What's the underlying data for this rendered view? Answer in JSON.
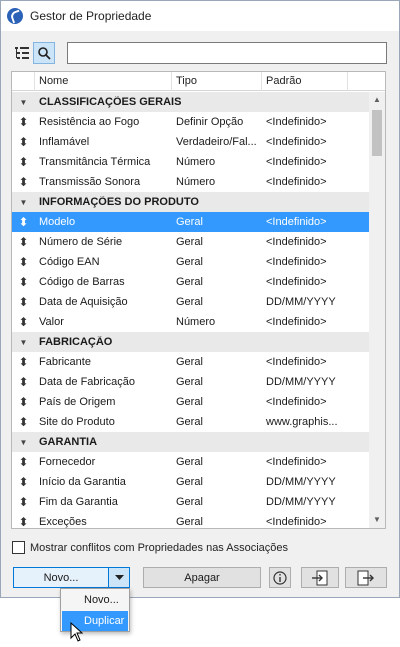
{
  "window": {
    "title": "Gestor de Propriedade",
    "icon": "app-logo-icon"
  },
  "toolbar": {
    "tree_view_icon": "tree-list-icon",
    "search_icon": "search-icon",
    "search_value": ""
  },
  "columns": {
    "name": "Nome",
    "type": "Tipo",
    "default": "Padrão"
  },
  "groups": [
    {
      "label": "CLASSIFICAÇÕES GERAIS",
      "items": [
        {
          "name": "Resistência ao Fogo",
          "type": "Definir Opção",
          "default": "<Indefinido>"
        },
        {
          "name": "Inflamável",
          "type": "Verdadeiro/Fal...",
          "default": "<Indefinido>"
        },
        {
          "name": "Transmitância Térmica",
          "type": "Número",
          "default": "<Indefinido>"
        },
        {
          "name": "Transmissão Sonora",
          "type": "Número",
          "default": "<Indefinido>"
        }
      ]
    },
    {
      "label": "INFORMAÇÕES DO PRODUTO",
      "items": [
        {
          "name": "Modelo",
          "type": "Geral",
          "default": "<Indefinido>",
          "selected": true
        },
        {
          "name": "Número de Série",
          "type": "Geral",
          "default": "<Indefinido>"
        },
        {
          "name": "Código EAN",
          "type": "Geral",
          "default": "<Indefinido>"
        },
        {
          "name": "Código de Barras",
          "type": "Geral",
          "default": "<Indefinido>"
        },
        {
          "name": "Data de Aquisição",
          "type": "Geral",
          "default": "DD/MM/YYYY"
        },
        {
          "name": "Valor",
          "type": "Número",
          "default": "<Indefinido>"
        }
      ]
    },
    {
      "label": "FABRICAÇÃO",
      "items": [
        {
          "name": "Fabricante",
          "type": "Geral",
          "default": "<Indefinido>"
        },
        {
          "name": "Data de Fabricação",
          "type": "Geral",
          "default": "DD/MM/YYYY"
        },
        {
          "name": "País de Origem",
          "type": "Geral",
          "default": "<Indefinido>"
        },
        {
          "name": "Site do Produto",
          "type": "Geral",
          "default": "www.graphis..."
        }
      ]
    },
    {
      "label": "GARANTIA",
      "items": [
        {
          "name": "Fornecedor",
          "type": "Geral",
          "default": "<Indefinido>"
        },
        {
          "name": "Início da Garantia",
          "type": "Geral",
          "default": "DD/MM/YYYY"
        },
        {
          "name": "Fim da Garantia",
          "type": "Geral",
          "default": "DD/MM/YYYY"
        },
        {
          "name": "Exceções",
          "type": "Geral",
          "default": "<Indefinido>"
        }
      ]
    }
  ],
  "footer": {
    "conflict_label": "Mostrar conflitos com Propriedades nas Associações",
    "conflict_checked": false,
    "novo_label": "Novo...",
    "apagar_label": "Apagar",
    "info_icon": "info-icon",
    "import_icon": "import-icon",
    "export_icon": "export-icon"
  },
  "dropdown": {
    "items": [
      "Novo...",
      "Duplicar"
    ],
    "highlighted": "Duplicar"
  },
  "colors": {
    "selection": "#3399ff",
    "group_bg": "#e9e9e9",
    "focus_border": "#0078d7"
  }
}
